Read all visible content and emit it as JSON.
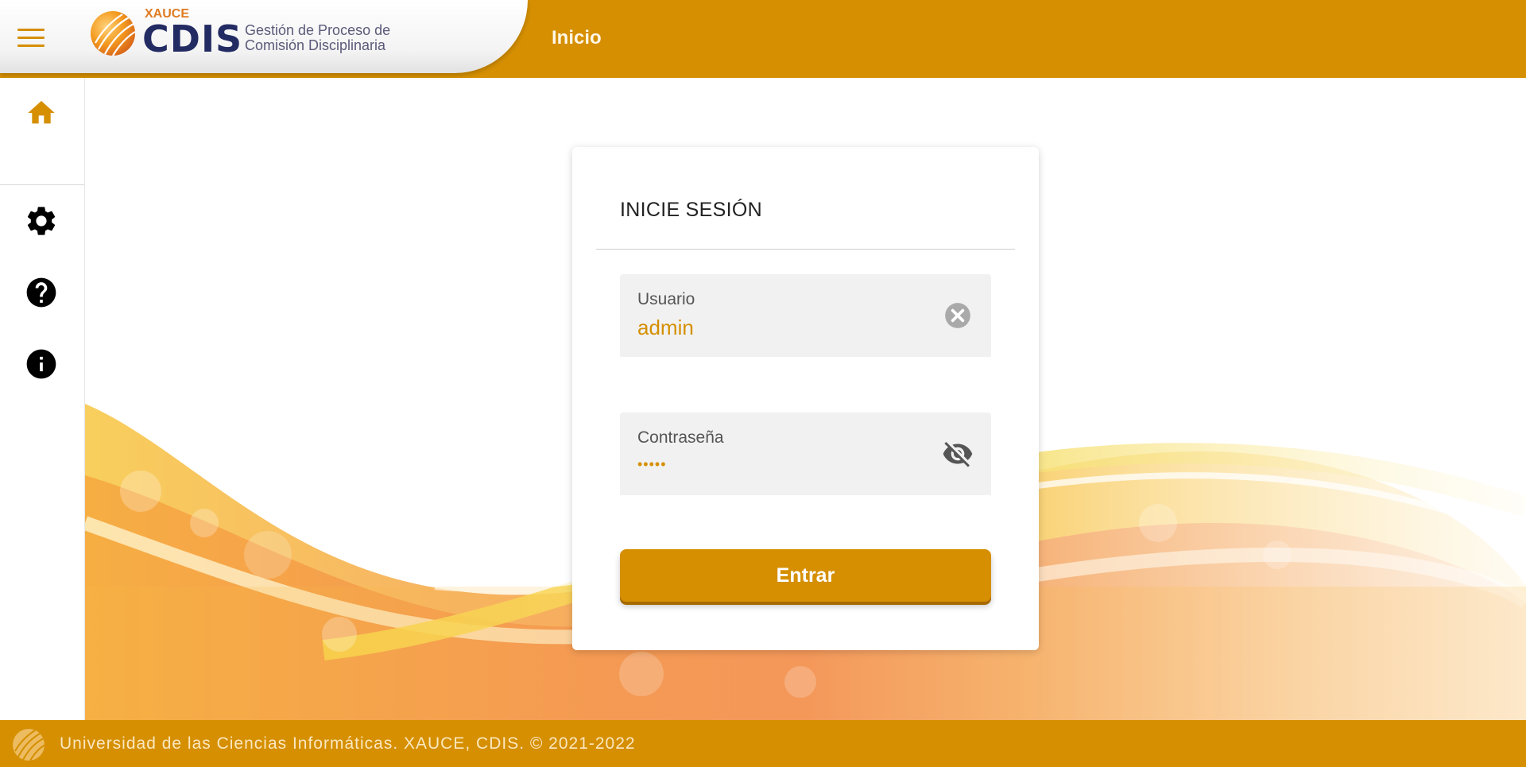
{
  "header": {
    "brand_small": "XAUCE",
    "brand_name": "CDIS",
    "tagline_line1": "Gestión de Proceso de",
    "tagline_line2": "Comisión Disciplinaria",
    "page_title": "Inicio"
  },
  "sidebar": {
    "items": [
      {
        "icon": "home-icon"
      },
      {
        "icon": "gear-icon"
      },
      {
        "icon": "help-icon"
      },
      {
        "icon": "info-icon"
      }
    ]
  },
  "login": {
    "title": "INICIE SESIÓN",
    "username_label": "Usuario",
    "username_value": "admin",
    "password_label": "Contraseña",
    "password_mask": "•••••",
    "submit_label": "Entrar"
  },
  "footer": {
    "text": "Universidad de las Ciencias Informáticas. XAUCE, CDIS. © 2021-2022"
  },
  "colors": {
    "accent": "#d58f00",
    "brand_dark": "#232b63",
    "brand_orange": "#e07b22"
  }
}
